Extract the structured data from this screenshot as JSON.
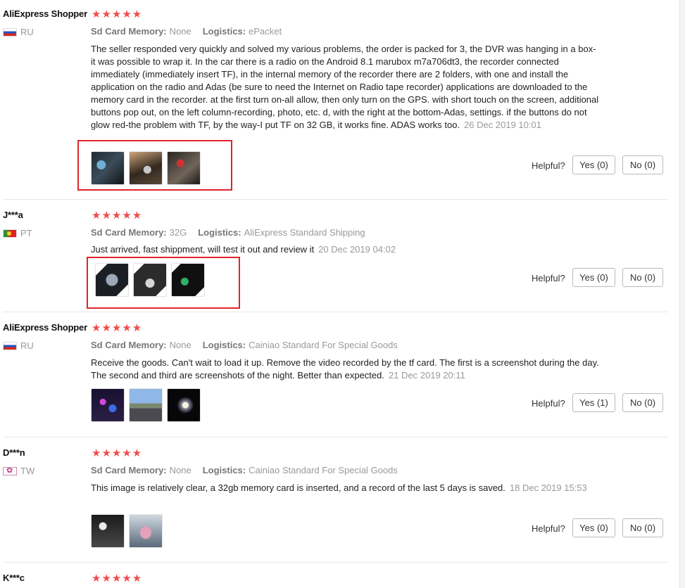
{
  "labels": {
    "sd_card": "Sd Card Memory:",
    "logistics": "Logistics:",
    "helpful": "Helpful?"
  },
  "colors": {
    "star": "#f04c4c",
    "highlight": "#e0242a"
  },
  "reviews": [
    {
      "name": "AliExpress Shopper",
      "country": "RU",
      "flag": "russia-flag-icon",
      "stars": "★★★★★",
      "sd_card": "None",
      "logistics": "ePacket",
      "text": "The seller responded very quickly and solved my various problems, the order is packed for 3, the DVR was hanging in a box-it was possible to wrap it. In the car there is a radio on the Android 8.1 marubox m7a706dt3, the recorder connected immediately (immediately insert TF), in the internal memory of the recorder there are 2 folders, with one and install the application on the radio and Adas (be sure to need the Internet on Radio tape recorder) applications are downloaded to the memory card in the recorder. at the first turn on-all allow, then only turn on the GPS. with short touch on the screen, additional buttons pop out, on the left column-recording, photo, etc. d, with the right at the bottom-Adas, settings. if the buttons do not glow red-the problem with TF, by the way-I put TF on 32 GB, it works fine. ADAS works too.",
      "date": "26 Dec 2019 10:01",
      "yes": "Yes (0)",
      "no": "No (0)"
    },
    {
      "name": "J***a",
      "country": "PT",
      "flag": "portugal-flag-icon",
      "stars": "★★★★★",
      "sd_card": "32G",
      "logistics": "AliExpress Standard Shipping",
      "text": "Just arrived, fast shippment, will test it out and review it",
      "date": "20 Dec 2019 04:02",
      "yes": "Yes (0)",
      "no": "No (0)"
    },
    {
      "name": "AliExpress Shopper",
      "country": "RU",
      "flag": "russia-flag-icon",
      "stars": "★★★★★",
      "sd_card": "None",
      "logistics": "Cainiao Standard For Special Goods",
      "text": "Receive the goods. Can't wait to load it up. Remove the video recorded by the tf card. The first is a screenshot during the day. The second and third are screenshots of the night. Better than expected.",
      "date": "21 Dec 2019 20:11",
      "yes": "Yes (1)",
      "no": "No (0)"
    },
    {
      "name": "D***n",
      "country": "TW",
      "flag": "taiwan-flag-icon",
      "stars": "★★★★★",
      "sd_card": "None",
      "logistics": "Cainiao Standard For Special Goods",
      "text": "This image is relatively clear, a 32gb memory card is inserted, and a record of the last 5 days is saved.",
      "date": "18 Dec 2019 15:53",
      "yes": "Yes (0)",
      "no": "No (0)"
    },
    {
      "name": "K***c",
      "stars": "★★★★★"
    }
  ]
}
